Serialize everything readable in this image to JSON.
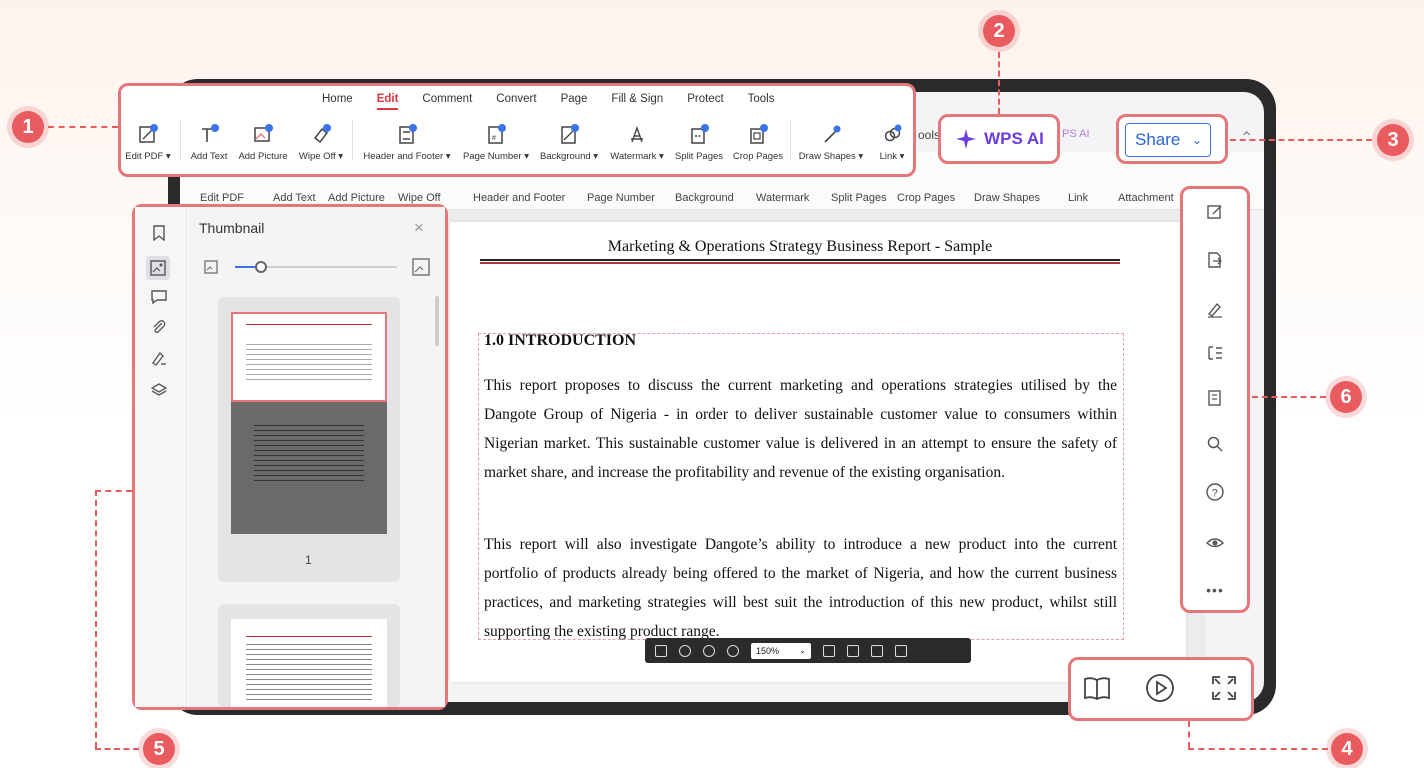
{
  "ribbon": {
    "tabs": [
      "Home",
      "Edit",
      "Comment",
      "Convert",
      "Page",
      "Fill & Sign",
      "Protect",
      "Tools"
    ],
    "active_tab": "Edit",
    "tools": [
      {
        "label": "Edit PDF",
        "dropdown": true
      },
      {
        "label": "Add Text",
        "dropdown": false
      },
      {
        "label": "Add Picture",
        "dropdown": false
      },
      {
        "label": "Wipe Off",
        "dropdown": true
      },
      {
        "label": "Header and Footer",
        "dropdown": true
      },
      {
        "label": "Page Number",
        "dropdown": true
      },
      {
        "label": "Background",
        "dropdown": true
      },
      {
        "label": "Watermark",
        "dropdown": true
      },
      {
        "label": "Split Pages",
        "dropdown": false
      },
      {
        "label": "Crop Pages",
        "dropdown": false
      },
      {
        "label": "Draw Shapes",
        "dropdown": true
      },
      {
        "label": "Link",
        "dropdown": true
      }
    ]
  },
  "bg_ribbon": {
    "tools": [
      "Edit PDF",
      "Add Text",
      "Add Picture",
      "Wipe Off",
      "Header and Footer",
      "Page Number",
      "Background",
      "Watermark",
      "Split Pages",
      "Crop Pages",
      "Draw Shapes",
      "Link",
      "Attachment"
    ],
    "partial_labels": [
      "ools",
      "PS AI"
    ]
  },
  "wps_ai": {
    "label": "WPS AI",
    "accent": "#6b3de0"
  },
  "share": {
    "label": "Share",
    "accent": "#3b74e8"
  },
  "thumbnail_panel": {
    "title": "Thumbnail",
    "page_label": "1",
    "rail_icons": [
      "bookmark-icon",
      "thumbnail-icon",
      "comment-icon",
      "attachment-icon",
      "signature-icon",
      "layers-icon"
    ]
  },
  "document": {
    "title": "Marketing & Operations Strategy Business Report - Sample",
    "heading": "1.0 INTRODUCTION",
    "paragraph1": "This report proposes to discuss the current marketing and operations strategies utilised by the Dangote Group of Nigeria - in order to deliver sustainable customer value to consumers within Nigerian market. This sustainable customer value is delivered in an attempt to ensure the safety of market share, and increase the profitability and revenue of the existing organisation.",
    "paragraph2": "This report will also investigate Dangote’s ability to introduce a new product into the current portfolio of products already being offered to the market of Nigeria, and how the current business practices, and marketing strategies will best suit the introduction of this new product, whilst still supporting the existing product range."
  },
  "doc_toolbar": {
    "zoom": "150%"
  },
  "right_toolbar": {
    "icons": [
      "edit-icon",
      "export-icon",
      "sign-icon",
      "outline-icon",
      "compare-icon",
      "search-icon",
      "help-icon",
      "eye-protection-icon",
      "more-icon"
    ]
  },
  "bottom_right": {
    "icons": [
      "read-mode-icon",
      "play-icon",
      "fullscreen-icon"
    ]
  },
  "badges": [
    "1",
    "2",
    "3",
    "4",
    "5",
    "6"
  ],
  "colors": {
    "callout": "#e6767a",
    "badge": "#ea5b5f",
    "active_tab": "#d9363e"
  }
}
